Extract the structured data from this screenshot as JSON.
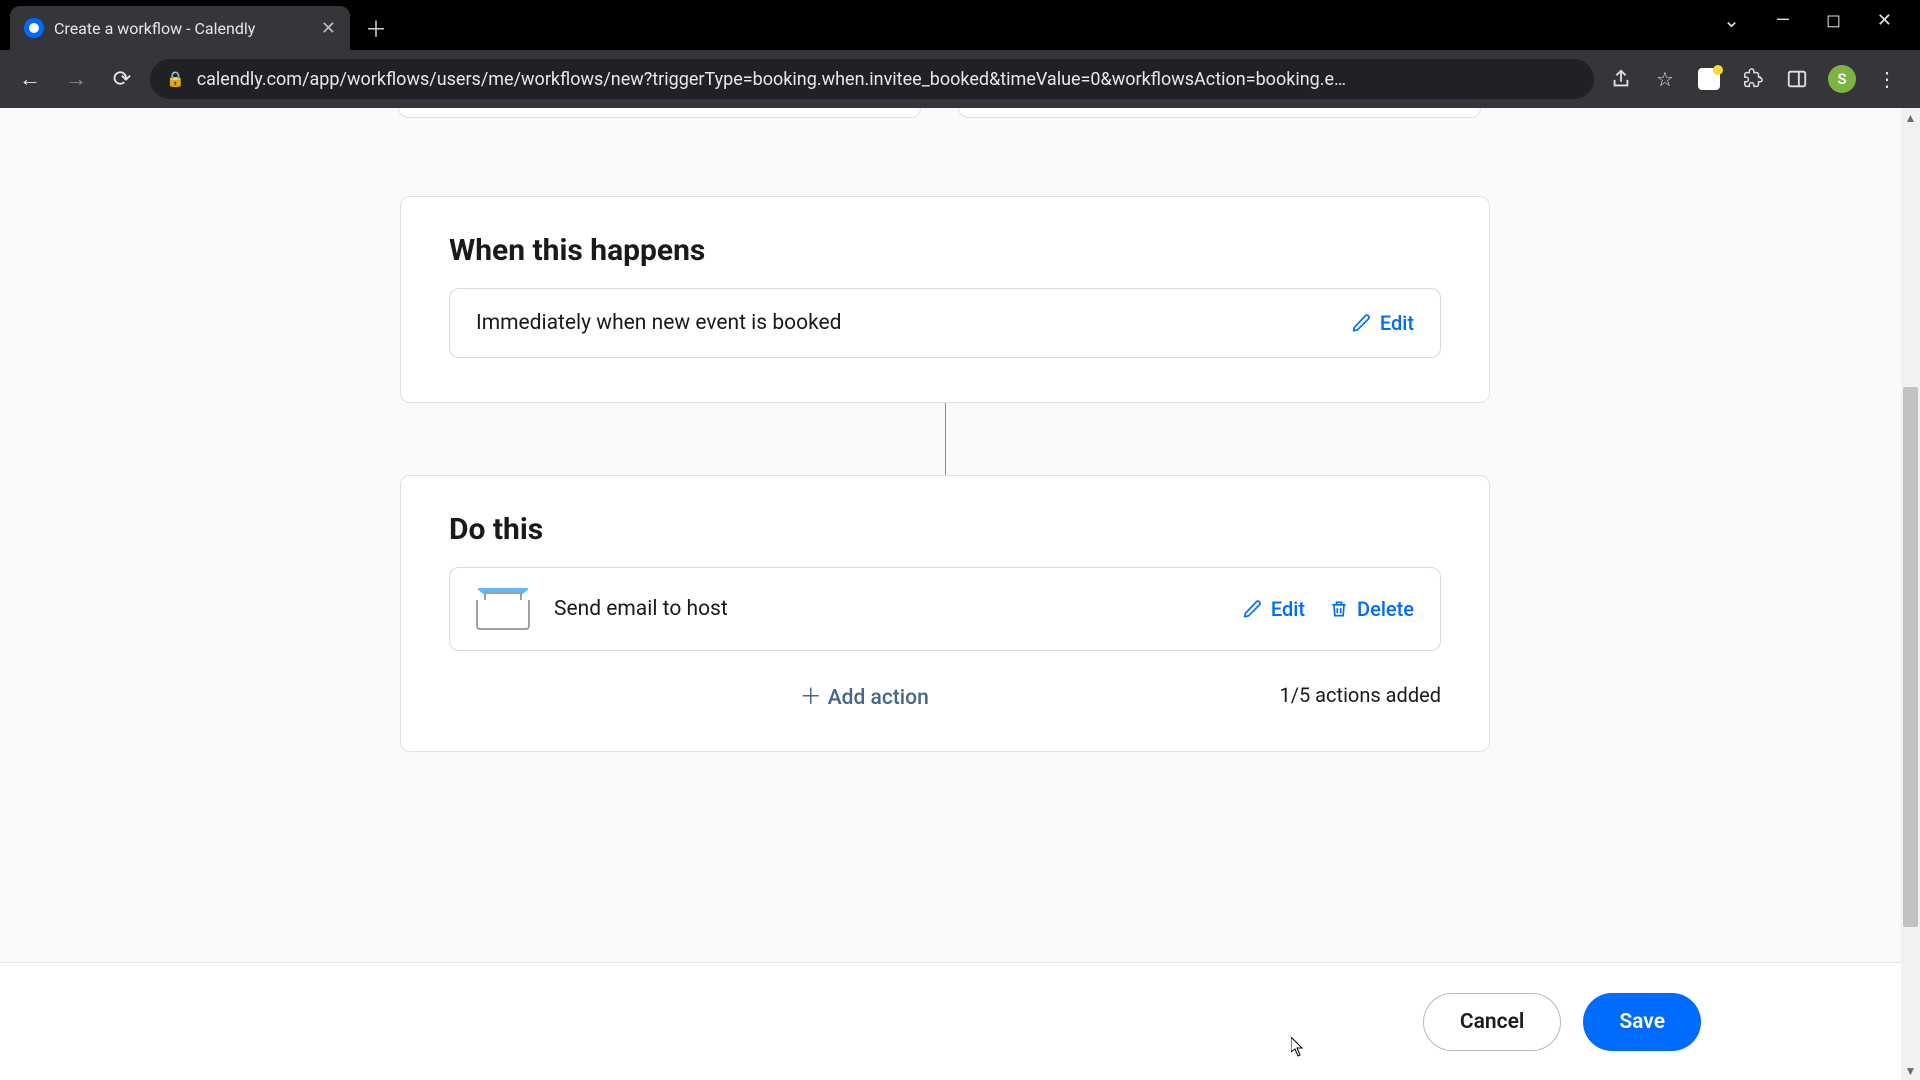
{
  "browser": {
    "tab_title": "Create a workflow - Calendly",
    "url": "calendly.com/app/workflows/users/me/workflows/new?triggerType=booking.when.invitee_booked&timeValue=0&workflowsAction=booking.e…",
    "avatar_letter": "S"
  },
  "workflow": {
    "trigger": {
      "heading": "When this happens",
      "description": "Immediately when new event is booked",
      "edit_label": "Edit"
    },
    "actions": {
      "heading": "Do this",
      "items": [
        {
          "label": "Send email to host",
          "edit_label": "Edit",
          "delete_label": "Delete"
        }
      ],
      "add_label": "Add action",
      "count_label": "1/5 actions added"
    }
  },
  "footer": {
    "cancel_label": "Cancel",
    "save_label": "Save"
  }
}
